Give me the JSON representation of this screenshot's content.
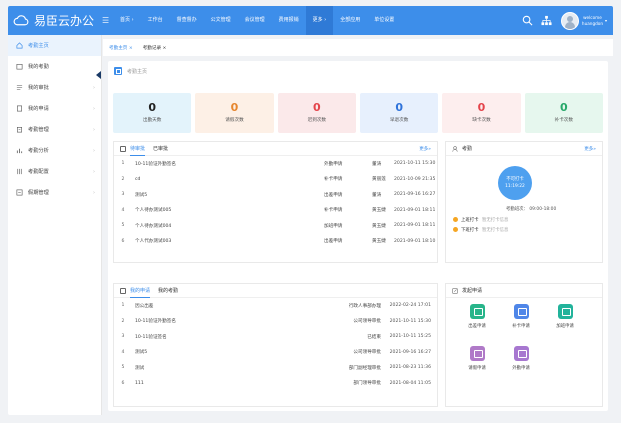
{
  "topbar": {
    "app_name": "易臣云办公",
    "nav": [
      "首页 ›",
      "工作台",
      "督查督办",
      "公文管理",
      "会议管理",
      "费用报销",
      "更多 ›",
      "全部应用",
      "单位设置"
    ],
    "welcome": "welcome",
    "user": "huangdon"
  },
  "sidebar": {
    "items": [
      "考勤主页",
      "我的考勤",
      "我的审批",
      "我的申请",
      "考勤管理",
      "考勤分析",
      "考勤配置",
      "假期管理"
    ]
  },
  "tabs": [
    "考勤主页 ×",
    "考勤记录 ×"
  ],
  "breadcrumb": "考勤主页",
  "stats": [
    {
      "value": "0",
      "label": "出勤天数",
      "bg": "#e3f3fb",
      "color": "#222"
    },
    {
      "value": "0",
      "label": "请假次数",
      "bg": "#fdf0e6",
      "color": "#e6862e"
    },
    {
      "value": "0",
      "label": "迟到次数",
      "bg": "#fbe9ea",
      "color": "#e4444b"
    },
    {
      "value": "0",
      "label": "早退次数",
      "bg": "#e7f0fd",
      "color": "#2f73da"
    },
    {
      "value": "0",
      "label": "缺卡次数",
      "bg": "#fdeeee",
      "color": "#e4444b"
    },
    {
      "value": "0",
      "label": "补卡次数",
      "bg": "#e6f7ee",
      "color": "#27a869"
    }
  ],
  "approval": {
    "tabs": [
      "待审批",
      "已审批"
    ],
    "more": "更多»",
    "rows": [
      {
        "n": "1",
        "title": "10-11验证外勤签名",
        "type": "外勤申请",
        "who": "董涛",
        "time": "2021-10-11 15:30"
      },
      {
        "n": "2",
        "title": "cd",
        "type": "补卡申请",
        "who": "黄丽莲",
        "time": "2021-10-09 21:35"
      },
      {
        "n": "3",
        "title": "测试5",
        "type": "出差申请",
        "who": "董涛",
        "time": "2021-09-16 16:27"
      },
      {
        "n": "4",
        "title": "个人待办测试005",
        "type": "补卡申请",
        "who": "黄玉婕",
        "time": "2021-09-01 18:11"
      },
      {
        "n": "5",
        "title": "个人待办测试004",
        "type": "加班申请",
        "who": "黄玉婕",
        "time": "2021-09-01 18:11"
      },
      {
        "n": "6",
        "title": "个人代办测试003",
        "type": "出差申请",
        "who": "黄玉婕",
        "time": "2021-09-01 18:10"
      }
    ]
  },
  "attendance": {
    "title": "考勤",
    "more": "更多»",
    "clock_status": "不可打卡",
    "clock_time": "11:19:22",
    "shift": "考勤班次：  09:00-18:00",
    "on_label": "上班打卡",
    "on_note": "暂无打卡信息",
    "off_label": "下班打卡",
    "off_note": "暂无打卡信息"
  },
  "my_requests": {
    "tabs": [
      "我的申请",
      "我的考勤"
    ],
    "rows": [
      {
        "n": "1",
        "title": "因公出差",
        "status": "行政人事部办理",
        "time": "2022-02-24 17:01"
      },
      {
        "n": "2",
        "title": "10-11验证外勤签名",
        "status": "公司领导审批",
        "time": "2021-10-11 15:30"
      },
      {
        "n": "3",
        "title": "10-11验证签名",
        "status": "已结束",
        "time": "2021-10-11 15:25"
      },
      {
        "n": "4",
        "title": "测试5",
        "status": "公司领导审批",
        "time": "2021-09-16 16:27"
      },
      {
        "n": "5",
        "title": "测试",
        "status": "部门副经理审批",
        "time": "2021-08-23 11:36"
      },
      {
        "n": "6",
        "title": "111",
        "status": "部门领导审批",
        "time": "2021-08-04 11:05"
      }
    ]
  },
  "launch": {
    "title": "发起申请",
    "apps": [
      {
        "label": "出差申请",
        "color": "#27b58a"
      },
      {
        "label": "补卡申请",
        "color": "#4f86e8"
      },
      {
        "label": "加班申请",
        "color": "#22b39b"
      },
      {
        "label": "请假申请",
        "color": "#b07ac8"
      },
      {
        "label": "外勤申请",
        "color": "#a777d0"
      }
    ]
  }
}
